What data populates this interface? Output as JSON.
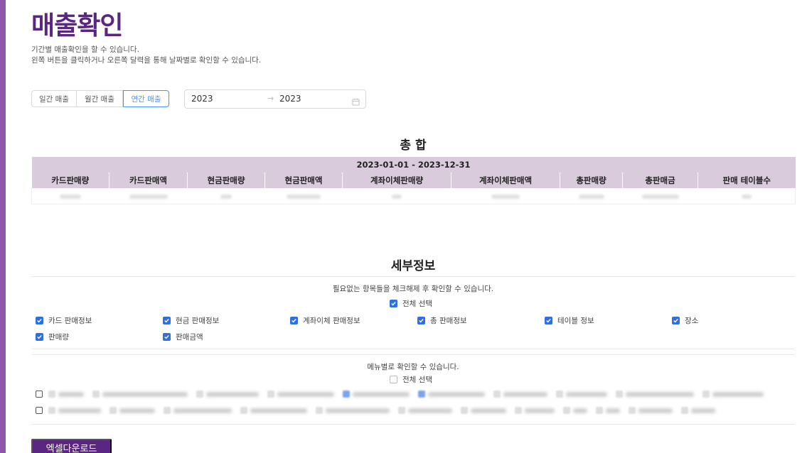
{
  "page": {
    "title": "매출확인",
    "desc1": "기간별 매출확인을 할 수 있습니다.",
    "desc2": "왼쪽 버튼을 클릭하거나 오른쪽 달력을 통해 날짜별로 확인할 수 있습니다."
  },
  "period": {
    "buttons": [
      "일간 매출",
      "월간 매출",
      "연간 매출"
    ],
    "selected": "연간 매출",
    "range_start": "2023",
    "range_arrow": "→",
    "range_end": "2023"
  },
  "summary": {
    "title": "총 합",
    "date_range": "2023-01-01 - 2023-12-31",
    "columns": [
      "카드판매량",
      "카드판매액",
      "현금판매량",
      "현금판매액",
      "계좌이체판매량",
      "계좌이체판매액",
      "총판매량",
      "총판매금",
      "판매 테이블수"
    ]
  },
  "detail": {
    "title": "세부정보",
    "hint": "필요없는 항목들을 체크해제 후 확인할 수 있습니다.",
    "select_all": "전체 선택",
    "options": [
      "카드 판매정보",
      "현금 판매정보",
      "계좌이체 판매정보",
      "총 판매정보",
      "테이블 정보",
      "장소",
      "판매량",
      "판매금액"
    ],
    "menu_hint": "메뉴별로 확인할 수 있습니다.",
    "menu_select_all": "전체 선택"
  },
  "actions": {
    "excel_download": "엑셀다운로드"
  },
  "colors": {
    "brand": "#5a2682",
    "header_bg": "#d9cbdb",
    "accent": "#4096ff",
    "checkbox": "#2f6fe0"
  }
}
